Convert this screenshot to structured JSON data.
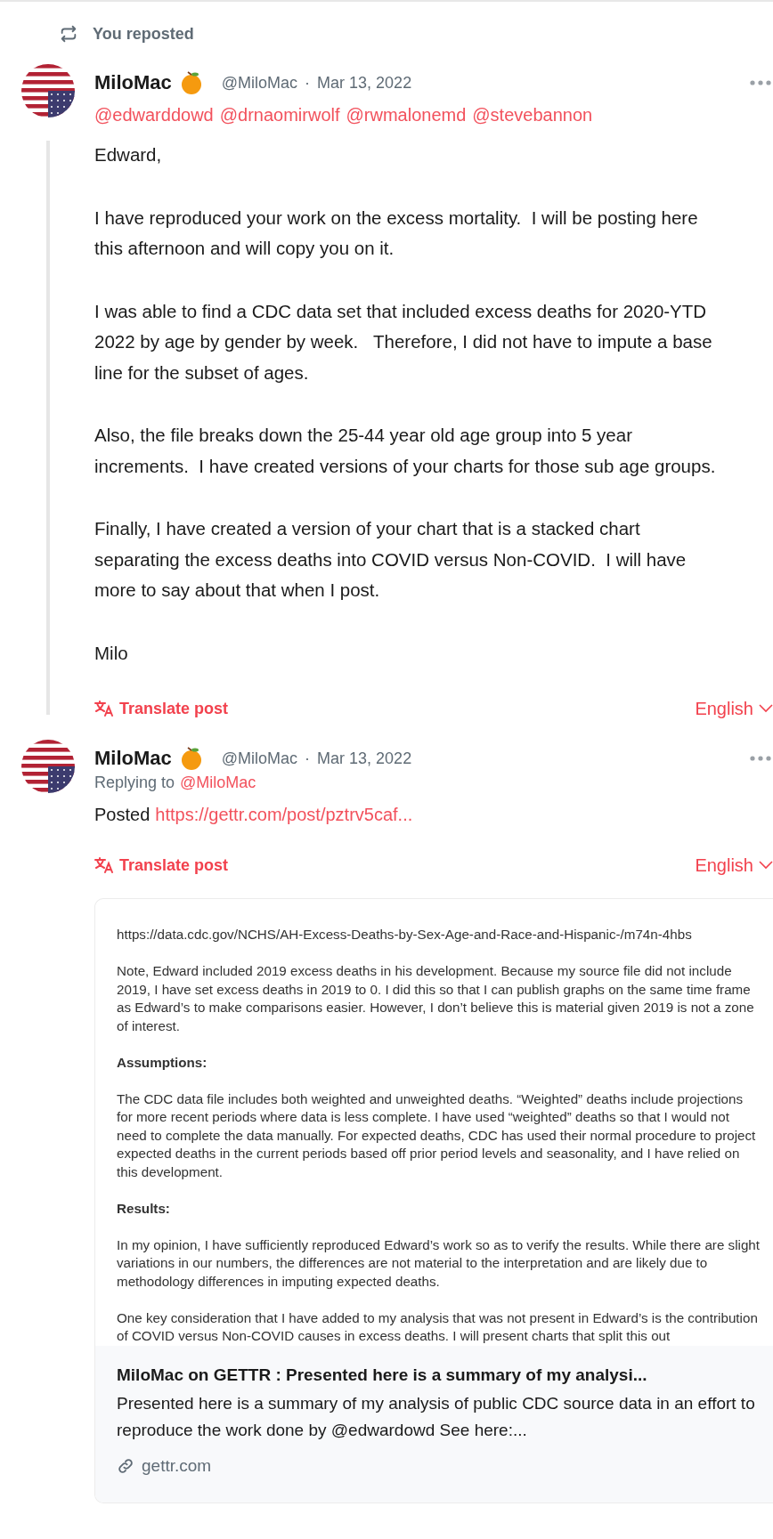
{
  "repost_banner": {
    "label": "You reposted"
  },
  "posts": [
    {
      "author": "MiloMac",
      "handle": "@MiloMac",
      "separator": "·",
      "date": "Mar 13, 2022",
      "mentions": [
        "@edwarddowd",
        "@drnaomirwolf",
        "@rwmalonemd",
        "@stevebannon"
      ],
      "threaded": true,
      "paragraphs": [
        "Edward,",
        "I have reproduced your work on the excess mortality.  I will be posting here this afternoon and will copy you on it.",
        "I was able to find a CDC data set that included excess deaths for 2020-YTD 2022 by age by gender by week.   Therefore, I did not have to impute a base line for the subset of ages.",
        "Also, the file breaks down the 25-44 year old age group into 5 year increments.  I have created versions of your charts for those sub age groups.",
        "Finally, I have created a version of your chart that is a stacked chart separating the excess deaths into COVID versus Non-COVID.  I will have more to say about that when I post.",
        "Milo"
      ],
      "translate": "Translate post",
      "language": "English"
    },
    {
      "author": "MiloMac",
      "handle": "@MiloMac",
      "separator": "·",
      "date": "Mar 13, 2022",
      "threaded": false,
      "replying_label": "Replying to",
      "replying_to": "@MiloMac",
      "text": "Posted",
      "link": "https://gettr.com/post/pztrv5caf...",
      "translate": "Translate post",
      "language": "English",
      "preview": {
        "document": [
          {
            "kind": "text",
            "text": "https://data.cdc.gov/NCHS/AH-Excess-Deaths-by-Sex-Age-and-Race-and-Hispanic-/m74n-4hbs"
          },
          {
            "kind": "text",
            "text": "Note, Edward included 2019 excess deaths in his development.  Because my source file did not include 2019, I have set excess deaths in 2019 to 0.  I did this so that I can publish graphs on the same time frame as Edward’s to make comparisons easier.  However, I don’t believe this is material given 2019 is not a zone of interest."
          },
          {
            "kind": "heading",
            "text": "Assumptions:"
          },
          {
            "kind": "text",
            "text": "The CDC data file includes both weighted and unweighted deaths.   “Weighted” deaths include projections for more recent periods where data is less complete.  I have used “weighted” deaths so that I would not need to complete the data manually.   For expected deaths, CDC has used their normal procedure to project expected deaths in the current periods based off prior period levels and seasonality, and I have relied on this development."
          },
          {
            "kind": "heading",
            "text": "Results:"
          },
          {
            "kind": "text",
            "text": "In my opinion, I have sufficiently reproduced Edward’s work so as to verify the results.  While there are slight variations in our numbers, the differences are not material to the interpretation and are likely due to methodology differences in imputing expected deaths."
          },
          {
            "kind": "text",
            "text": "One key consideration that I have added to my analysis that was not present in Edward’s is the contribution of COVID versus Non-COVID causes in excess deaths.  I will present charts that split this out"
          }
        ],
        "title": "MiloMac on GETTR : Presented here is a summary of my analysi...",
        "description": "Presented here is a summary of my analysis of public CDC source data in an effort to reproduce the work done by @edwardowd See here:...",
        "domain": "gettr.com"
      }
    }
  ]
}
